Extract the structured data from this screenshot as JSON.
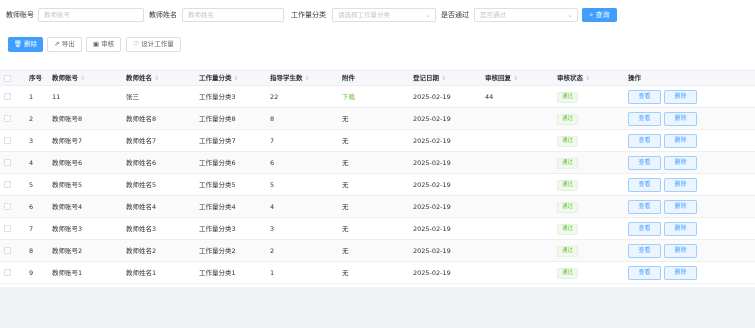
{
  "filters": {
    "teacher_account_label": "教师账号",
    "teacher_account_placeholder": "教师账号",
    "teacher_name_label": "教师姓名",
    "teacher_name_placeholder": "教师姓名",
    "work_category_label": "工作量分类",
    "work_category_placeholder": "请选择工作量分类",
    "passed_label": "是否通过",
    "passed_placeholder": "是否通过",
    "query_label": "查询"
  },
  "toolbar": {
    "delete_label": "删除",
    "export_label": "导出",
    "review_label": "审核",
    "design_label": "设计工作量"
  },
  "table": {
    "headers": {
      "index": "序号",
      "account": "教师账号",
      "name": "教师姓名",
      "category": "工作量分类",
      "students": "指导学生数",
      "attachment": "附件",
      "date": "登记日期",
      "reply": "审核回复",
      "status": "审核状态",
      "actions": "操作"
    },
    "view_label": "查看",
    "delete_label": "删除",
    "rows": [
      {
        "index": "1",
        "account": "11",
        "name": "张三",
        "category": "工作量分类3",
        "students": "22",
        "attachment": "下载",
        "date": "2025-02-19",
        "reply": "44",
        "status": "通过"
      },
      {
        "index": "2",
        "account": "教师账号8",
        "name": "教师姓名8",
        "category": "工作量分类8",
        "students": "8",
        "attachment": "无",
        "date": "2025-02-19",
        "reply": "",
        "status": "通过"
      },
      {
        "index": "3",
        "account": "教师账号7",
        "name": "教师姓名7",
        "category": "工作量分类7",
        "students": "7",
        "attachment": "无",
        "date": "2025-02-19",
        "reply": "",
        "status": "通过"
      },
      {
        "index": "4",
        "account": "教师账号6",
        "name": "教师姓名6",
        "category": "工作量分类6",
        "students": "6",
        "attachment": "无",
        "date": "2025-02-19",
        "reply": "",
        "status": "通过"
      },
      {
        "index": "5",
        "account": "教师账号5",
        "name": "教师姓名5",
        "category": "工作量分类5",
        "students": "5",
        "attachment": "无",
        "date": "2025-02-19",
        "reply": "",
        "status": "通过"
      },
      {
        "index": "6",
        "account": "教师账号4",
        "name": "教师姓名4",
        "category": "工作量分类4",
        "students": "4",
        "attachment": "无",
        "date": "2025-02-19",
        "reply": "",
        "status": "通过"
      },
      {
        "index": "7",
        "account": "教师账号3",
        "name": "教师姓名3",
        "category": "工作量分类3",
        "students": "3",
        "attachment": "无",
        "date": "2025-02-19",
        "reply": "",
        "status": "通过"
      },
      {
        "index": "8",
        "account": "教师账号2",
        "name": "教师姓名2",
        "category": "工作量分类2",
        "students": "2",
        "attachment": "无",
        "date": "2025-02-19",
        "reply": "",
        "status": "通过"
      },
      {
        "index": "9",
        "account": "教师账号1",
        "name": "教师姓名1",
        "category": "工作量分类1",
        "students": "1",
        "attachment": "无",
        "date": "2025-02-19",
        "reply": "",
        "status": "通过"
      }
    ]
  }
}
